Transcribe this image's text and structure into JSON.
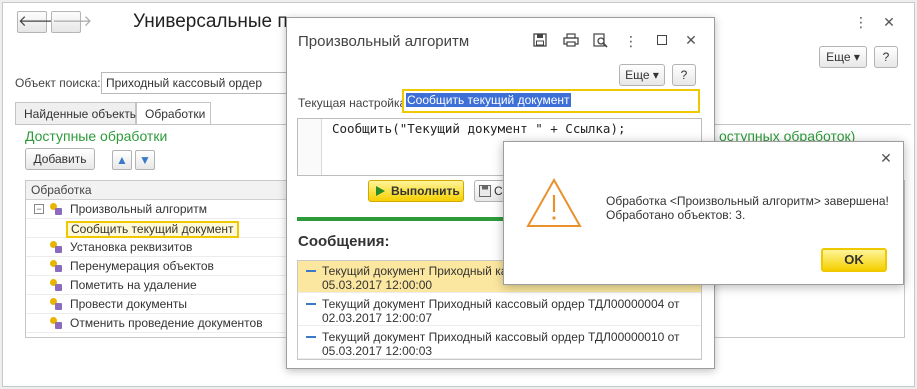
{
  "main_window": {
    "title": "Универсальные п",
    "back_icon": "arrow-left-icon",
    "forward_icon": "arrow-right-icon",
    "more_button": "Еще ▾",
    "help_button": "?",
    "search_label": "Объект поиска:",
    "search_value": "Приходный кассовый ордер",
    "tabs": [
      {
        "label": "Найденные объекты",
        "active": false
      },
      {
        "label": "Обработки",
        "active": true
      }
    ],
    "available_title": "Доступные обработки",
    "hidden_link_fragment": "оступных обработок)",
    "add_button": "Добавить",
    "tree_header": "Обработка",
    "tree_items": [
      {
        "label": "Произвольный алгоритм",
        "expanded": true
      },
      {
        "label": "Сообщить текущий документ",
        "selected": true
      },
      {
        "label": "Установка реквизитов"
      },
      {
        "label": "Перенумерация объектов"
      },
      {
        "label": "Пометить на удаление"
      },
      {
        "label": "Провести документы"
      },
      {
        "label": "Отменить проведение документов"
      }
    ]
  },
  "algo_window": {
    "title": "Произвольный алгоритм",
    "more_button": "Еще ▾",
    "help_button": "?",
    "setting_label": "Текущая настройка:",
    "setting_value": "Сообщить текущий документ",
    "code": "Сообщить(\"Текущий документ \" + Ссылка);",
    "run_button": "Выполнить",
    "save_button_fragment": "Со",
    "messages_title": "Сообщения:",
    "messages": [
      {
        "line1": "Текущий документ Приходный касс",
        "line2": "05.03.2017 12:00:00",
        "selected": true
      },
      {
        "line1": "Текущий документ Приходный кассовый ордер ТДЛ00000004 от",
        "line2": "02.03.2017 12:00:07"
      },
      {
        "line1": "Текущий документ Приходный кассовый ордер ТДЛ00000010 от",
        "line2": "05.03.2017 12:00:03"
      }
    ]
  },
  "alert": {
    "line1": "Обработка <Произвольный алгоритм> завершена!",
    "line2": "Обработано объектов: 3.",
    "ok_button": "OK",
    "icon": "warning-triangle-icon",
    "accent_color": "#f0c800",
    "warning_color": "#e8912d"
  }
}
